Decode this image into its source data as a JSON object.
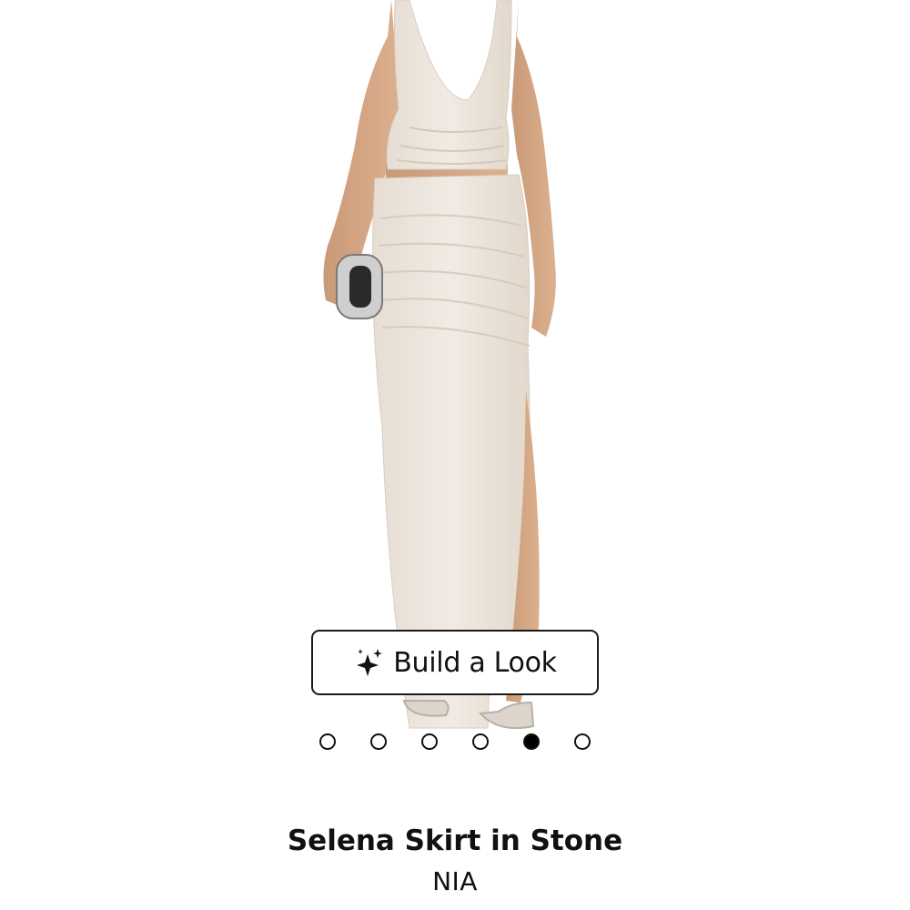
{
  "product": {
    "title": "Selena Skirt in Stone",
    "brand": "NIA",
    "image_alt": "model wearing stone halter top and ruched maxi skirt"
  },
  "build_look": {
    "label": "Build a Look",
    "icon": "sparkle-icon"
  },
  "carousel": {
    "total": 6,
    "active_index": 4
  },
  "colors": {
    "fabric": "#ece5dd",
    "text": "#111111",
    "background": "#ffffff"
  }
}
